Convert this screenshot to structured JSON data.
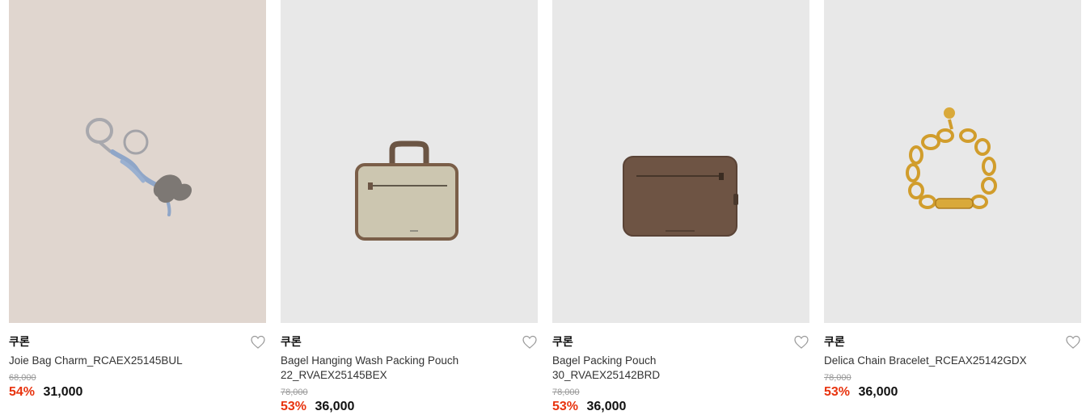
{
  "colors": {
    "card_bg_1": "#e0d6cf",
    "card_bg_default": "#e8e8e8",
    "discount": "#e8330e"
  },
  "products": [
    {
      "brand": "쿠론",
      "name": "Joie Bag Charm_RCAEX25145BUL",
      "original_price": "68,000",
      "discount": "54%",
      "price": "31,000",
      "image": "bag-charm-keyring",
      "liked": false
    },
    {
      "brand": "쿠론",
      "name": "Bagel Hanging Wash Packing Pouch 22_RVAEX25145BEX",
      "original_price": "78,000",
      "discount": "53%",
      "price": "36,000",
      "image": "beige-wash-pouch",
      "liked": false
    },
    {
      "brand": "쿠론",
      "name": "Bagel Packing Pouch 30_RVAEX25142BRD",
      "original_price": "78,000",
      "discount": "53%",
      "price": "36,000",
      "image": "brown-packing-pouch",
      "liked": false
    },
    {
      "brand": "쿠론",
      "name": "Delica Chain Bracelet_RCEAX25142GDX",
      "original_price": "78,000",
      "discount": "53%",
      "price": "36,000",
      "image": "gold-chain-bracelet",
      "liked": false
    }
  ]
}
